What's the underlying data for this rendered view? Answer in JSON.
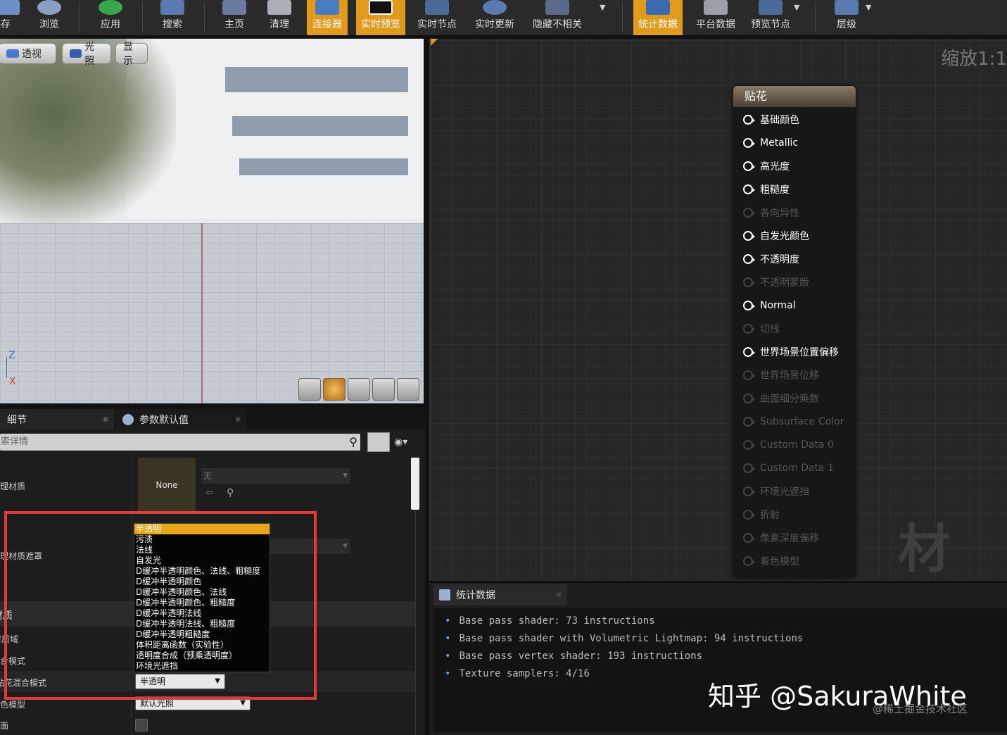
{
  "toolbar": {
    "buttons": [
      {
        "label": "保存"
      },
      {
        "label": "浏览"
      },
      {
        "label": "应用"
      },
      {
        "label": "搜索"
      },
      {
        "label": "主页"
      },
      {
        "label": "清理"
      },
      {
        "label": "连接器"
      },
      {
        "label": "实时预览"
      },
      {
        "label": "实时节点"
      },
      {
        "label": "实时更新"
      },
      {
        "label": "隐藏不相关"
      },
      {
        "label": "统计数据"
      },
      {
        "label": "平台数据"
      },
      {
        "label": "预览节点"
      },
      {
        "label": "层级"
      }
    ]
  },
  "viewport": {
    "buttons": {
      "perspective": "透视",
      "lighting": "光照",
      "show": "显示"
    },
    "axis": {
      "z": "Z",
      "x": "X"
    }
  },
  "details": {
    "tabs": {
      "details": "细节",
      "param_defaults": "参数默认值"
    },
    "search_placeholder": "搜索详情",
    "rows": {
      "physical_material": "物理材质",
      "physical_material_mask": "物理材质遮罩",
      "material_section": "材质",
      "material_domain": "材质域",
      "blend_mode": "混合模式",
      "decal_blend_mode": "贴花混合模式",
      "shading_model": "着色模型",
      "two_sided": "双面"
    },
    "none_thumb": "None",
    "phys_combo": "无",
    "decal_blend_value": "半透明",
    "shading_value": "默认光照",
    "dropdown_options": [
      "半透明",
      "污渍",
      "法线",
      "自发光",
      "D缓冲半透明颜色、法线、粗糙度",
      "D缓冲半透明颜色",
      "D缓冲半透明颜色、法线",
      "D缓冲半透明颜色、粗糙度",
      "D缓冲半透明法线",
      "D缓冲半透明法线、粗糙度",
      "D缓冲半透明粗糙度",
      "体积距离函数（实验性）",
      "透明度合成（预乘透明度）",
      "环境光遮挡"
    ]
  },
  "graph": {
    "zoom": "缩放1:1",
    "watermark": "材质",
    "node_title": "贴花",
    "pins": [
      {
        "label": "基础颜色",
        "enabled": true
      },
      {
        "label": "Metallic",
        "enabled": true
      },
      {
        "label": "高光度",
        "enabled": true
      },
      {
        "label": "粗糙度",
        "enabled": true
      },
      {
        "label": "各向异性",
        "enabled": false
      },
      {
        "label": "自发光颜色",
        "enabled": true
      },
      {
        "label": "不透明度",
        "enabled": true
      },
      {
        "label": "不透明蒙版",
        "enabled": false
      },
      {
        "label": "Normal",
        "enabled": true
      },
      {
        "label": "切线",
        "enabled": false
      },
      {
        "label": "世界场景位置偏移",
        "enabled": true
      },
      {
        "label": "世界场景位移",
        "enabled": false
      },
      {
        "label": "曲面细分乘数",
        "enabled": false
      },
      {
        "label": "Subsurface Color",
        "enabled": false
      },
      {
        "label": "Custom Data 0",
        "enabled": false
      },
      {
        "label": "Custom Data 1",
        "enabled": false
      },
      {
        "label": "环境光遮挡",
        "enabled": false
      },
      {
        "label": "折射",
        "enabled": false
      },
      {
        "label": "像素深度偏移",
        "enabled": false
      },
      {
        "label": "着色模型",
        "enabled": false
      }
    ]
  },
  "stats": {
    "tab": "统计数据",
    "lines": [
      "Base pass shader: 73 instructions",
      "Base pass shader with Volumetric Lightmap: 94 instructions",
      "Base pass vertex shader: 193 instructions",
      "Texture samplers: 4/16"
    ]
  },
  "watermarks": {
    "zhihu": "知乎 @SakuraWhite",
    "juejin": "@稀土掘金技术社区"
  },
  "colors": {
    "accent": "#e19a1c",
    "highlight_box": "#e03a3a"
  }
}
